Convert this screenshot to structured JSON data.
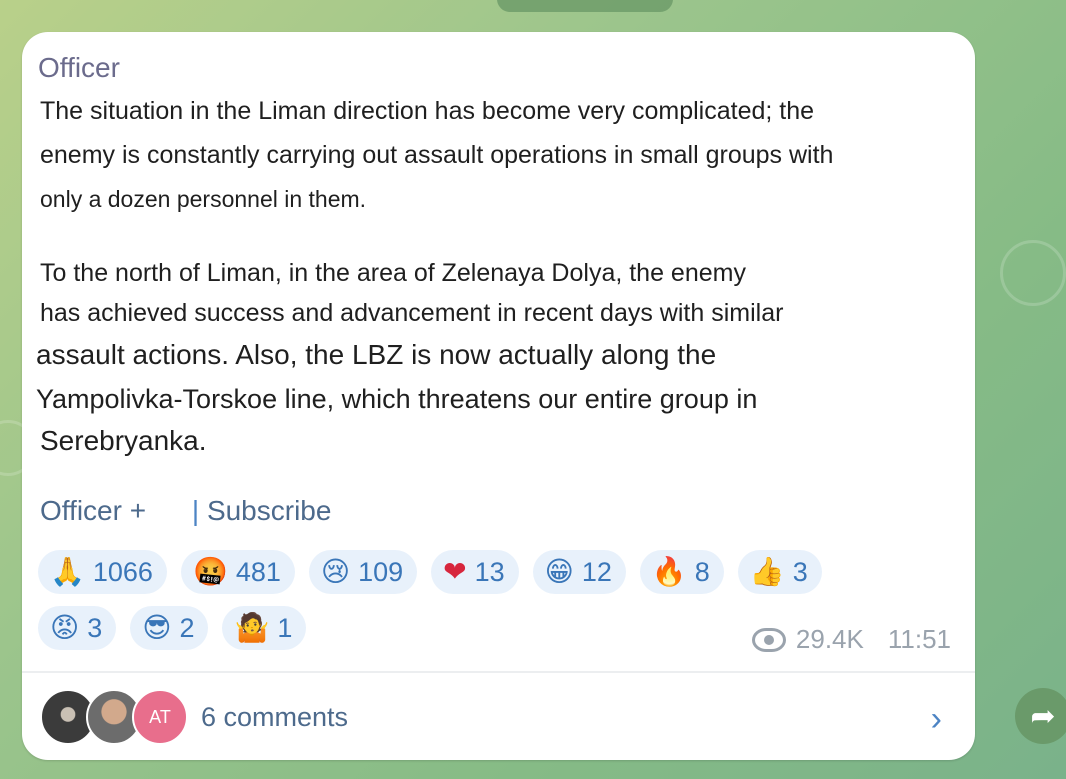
{
  "post": {
    "author": "Officer",
    "paragraph1": [
      "The situation in the Liman direction has become very complicated; the",
      "enemy is constantly carrying out assault operations in small groups with",
      "only a dozen personnel in them."
    ],
    "paragraph2": [
      "To the north of Liman, in the area of Zelenaya Dolya, the enemy",
      "has achieved success and advancement in recent days with similar",
      "assault actions. Also, the LBZ is now actually along the",
      "Yampolivka-Torskoe line, which threatens our entire group in",
      "Serebryanka."
    ],
    "links": {
      "channel": "Officer +",
      "separator": "|",
      "subscribe": "Subscribe"
    },
    "reactions_row1": [
      {
        "emoji": "🙏",
        "count": "1066"
      },
      {
        "emoji": "🤬",
        "count": "481"
      },
      {
        "emoji": "😢",
        "count": "109"
      },
      {
        "emoji": "❤",
        "count": "13"
      },
      {
        "emoji": "😁",
        "count": "12"
      },
      {
        "emoji": "🔥",
        "count": "8"
      },
      {
        "emoji": "👍",
        "count": "3"
      }
    ],
    "reactions_row2": [
      {
        "emoji": "😡",
        "count": "3"
      },
      {
        "emoji": "😎",
        "count": "2"
      },
      {
        "emoji": "🤷",
        "count": "1"
      }
    ],
    "views": "29.4K",
    "time": "11:51",
    "comments": {
      "avatar3_initials": "AT",
      "label": "6 comments",
      "chevron": "›"
    },
    "share_icon": "➦"
  }
}
